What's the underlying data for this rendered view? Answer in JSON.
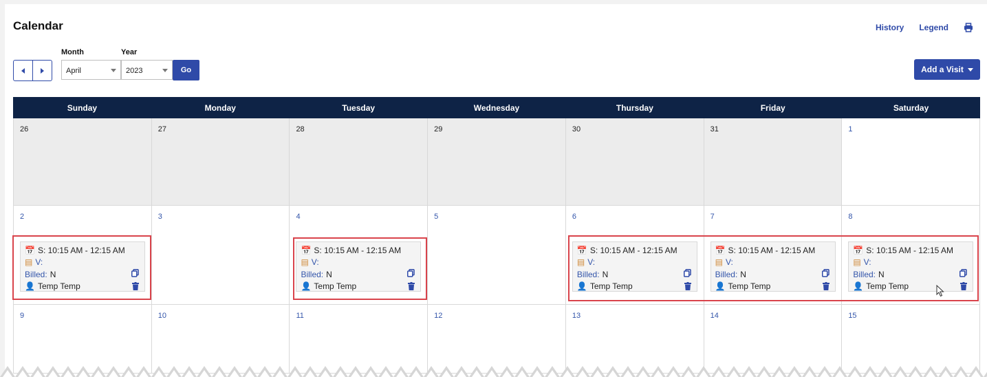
{
  "page": {
    "title": "Calendar",
    "links": {
      "history": "History",
      "legend": "Legend"
    },
    "print_icon": "printer-icon"
  },
  "controls": {
    "month_label": "Month",
    "year_label": "Year",
    "month_value": "April",
    "year_value": "2023",
    "go_label": "Go",
    "add_visit_label": "Add a Visit"
  },
  "calendar": {
    "weekdays": [
      "Sunday",
      "Monday",
      "Tuesday",
      "Wednesday",
      "Thursday",
      "Friday",
      "Saturday"
    ],
    "weeks": [
      [
        "26",
        "27",
        "28",
        "29",
        "30",
        "31",
        "1"
      ],
      [
        "2",
        "3",
        "4",
        "5",
        "6",
        "7",
        "8"
      ],
      [
        "9",
        "10",
        "11",
        "12",
        "13",
        "14",
        "15"
      ]
    ],
    "visit": {
      "time": "S: 10:15 AM - 12:15 AM",
      "v_label": "V:",
      "billed_label": "Billed:",
      "billed_value": "N",
      "person": "Temp Temp"
    }
  },
  "colors": {
    "header_bg": "#0e2346",
    "accent": "#2f4aa8",
    "highlight": "#d9434b"
  }
}
